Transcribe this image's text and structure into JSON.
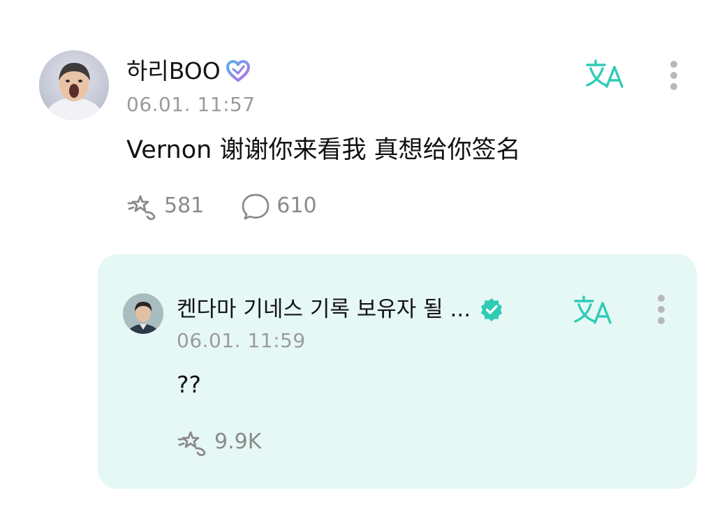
{
  "post": {
    "author": "하리BOO",
    "timestamp": "06.01. 11:57",
    "text": "Vernon 谢谢你来看我 真想给你签名",
    "likes": "581",
    "comments": "610",
    "avatar_icon": "avatar-photo",
    "badge_icon": "heart-badge-icon",
    "translate_icon": "translate-icon",
    "more_icon": "more-vertical-icon"
  },
  "reply": {
    "author": "켄다마 기네스 기록 보유자 될 ...",
    "timestamp": "06.01. 11:59",
    "text": "??",
    "likes": "9.9K",
    "avatar_icon": "avatar-photo",
    "badge_icon": "verified-badge-icon",
    "translate_icon": "translate-icon",
    "more_icon": "more-vertical-icon"
  },
  "colors": {
    "accent": "#2fcbb5",
    "reply_background": "#e6f8f5",
    "muted_text": "#9b9b9b",
    "icon_gray": "#8a8a8a",
    "heart_gradient": [
      "#5ab0f0",
      "#b46ee6"
    ]
  }
}
